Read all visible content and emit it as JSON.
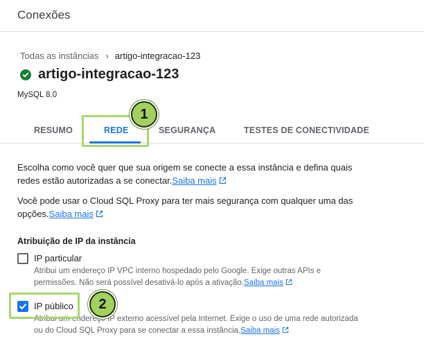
{
  "header": {
    "title": "Conexões"
  },
  "breadcrumb": {
    "parent": "Todas as instâncias",
    "separator": "›",
    "current": "artigo-integracao-123"
  },
  "instance": {
    "name": "artigo-integracao-123",
    "status_icon": "check-circle-icon",
    "version": "MySQL 8.0"
  },
  "tabs": [
    {
      "label": "RESUMO"
    },
    {
      "label": "REDE"
    },
    {
      "label": "SEGURANÇA"
    },
    {
      "label": "TESTES DE CONECTIVIDADE"
    }
  ],
  "annotations": {
    "badge1": "1",
    "badge2": "2"
  },
  "intro": {
    "line1": "Escolha como você quer que sua origem se conecte a essa instância e defina quais",
    "line2": "redes estão autorizadas a se conectar.",
    "link": "Saiba mais"
  },
  "proxy": {
    "line1": "Você pode usar o Cloud SQL Proxy para ter mais segurança com qualquer uma das",
    "line2": "opções.",
    "link": "Saiba mais"
  },
  "ip_section": {
    "title": "Atribuição de IP da instância",
    "private": {
      "label": "IP particular",
      "checked": false,
      "desc1": "Atribui um endereço IP VPC interno hospedado pelo Google. Exige outras APIs e",
      "desc2": "permissões. Não será possível desativá-lo após a ativação.",
      "link": "Saiba mais"
    },
    "public": {
      "label": "IP público",
      "checked": true,
      "desc1": "Atribui um endereço IP externo acessível pela Internet. Exige o uso de uma rede autorizada",
      "desc2": "ou do Cloud SQL Proxy para se conectar a essa instância.",
      "link": "Saiba mais"
    }
  },
  "colors": {
    "accent": "#1a73e8",
    "success": "#188038",
    "highlight": "#a5d86a",
    "badge": "#a2d160"
  }
}
